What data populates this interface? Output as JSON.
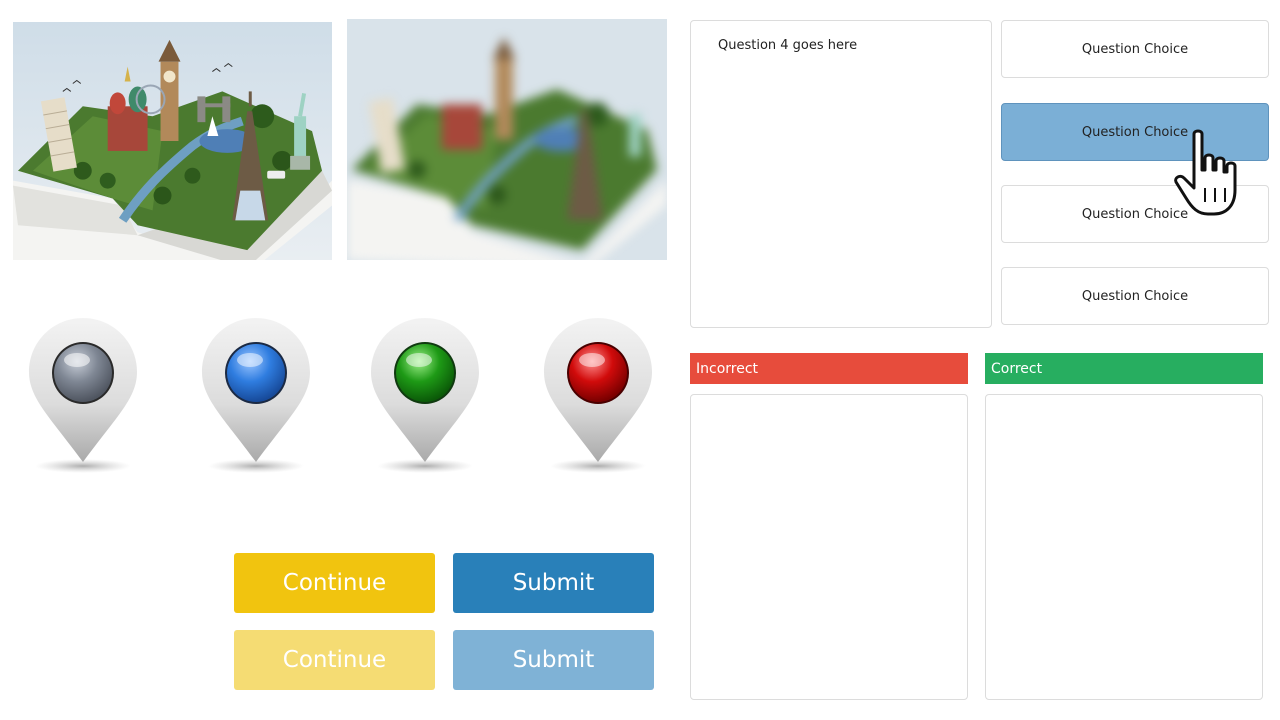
{
  "images": {
    "sharp_photo": {
      "icon": "pop-up-book-world-landmarks"
    },
    "blurred_photo": {
      "icon": "pop-up-book-world-landmarks-blurred"
    }
  },
  "pins": [
    {
      "name": "gray-pin",
      "color": "#7f8794"
    },
    {
      "name": "blue-pin",
      "color": "#2f7de0"
    },
    {
      "name": "green-pin",
      "color": "#1e9a16"
    },
    {
      "name": "red-pin",
      "color": "#d10b0b"
    }
  ],
  "buttons": {
    "continue_label": "Continue",
    "submit_label": "Submit",
    "continue_faded_label": "Continue",
    "submit_faded_label": "Submit",
    "continue_color": "#f1c40f",
    "submit_color": "#2980b9"
  },
  "question": {
    "text": "Question 4 goes here",
    "choices": [
      {
        "label": "Question Choice",
        "selected": false
      },
      {
        "label": "Question Choice",
        "selected": true
      },
      {
        "label": "Question Choice",
        "selected": false
      },
      {
        "label": "Question Choice",
        "selected": false
      }
    ]
  },
  "feedback": {
    "incorrect_label": "Incorrect",
    "correct_label": "Correct",
    "incorrect_color": "#e74c3c",
    "correct_color": "#27ae60"
  },
  "cursor": {
    "icon": "hand-pointer-icon"
  }
}
